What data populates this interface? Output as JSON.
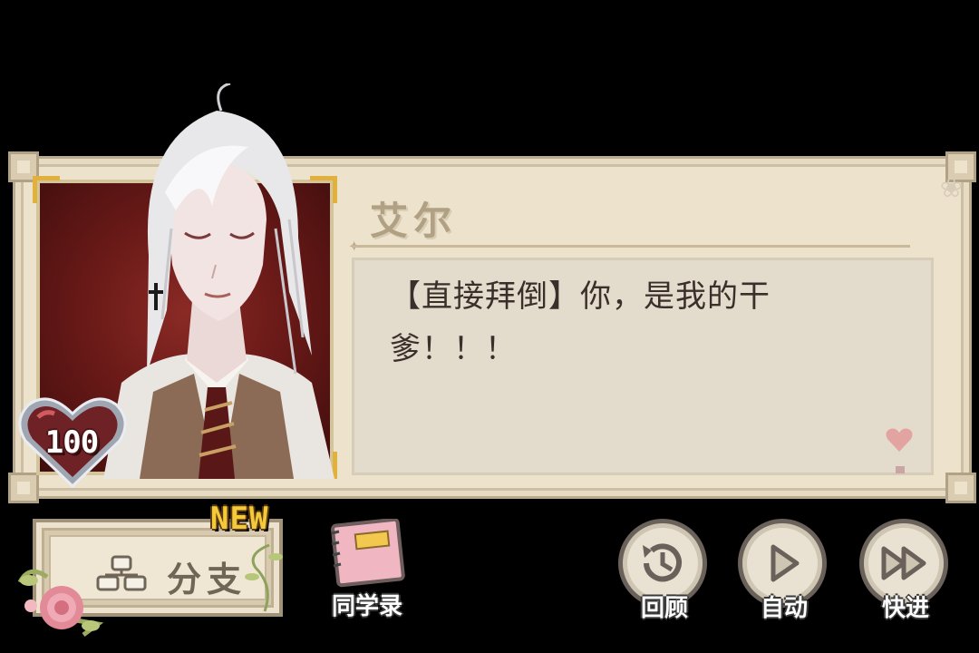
{
  "dialog": {
    "speaker": "艾尔",
    "line1": "【直接拜倒】你，是我的干",
    "line2": "爹！！！"
  },
  "affection": {
    "value": "100"
  },
  "controls": {
    "branch_label": "分支",
    "new_badge": "NEW",
    "classmates_label": "同学录",
    "review_label": "回顾",
    "auto_label": "自动",
    "skip_label": "快进"
  },
  "colors": {
    "frame": "#ede3cd",
    "portrait_bg": "#6a1a18",
    "gold_accent": "#e2b13c",
    "text": "#3a2f2a",
    "new_badge": "#f4c93a"
  },
  "icons": [
    "heart-icon",
    "branch-icon",
    "notebook-icon",
    "history-icon",
    "play-icon",
    "fast-forward-icon",
    "rose-icon"
  ]
}
